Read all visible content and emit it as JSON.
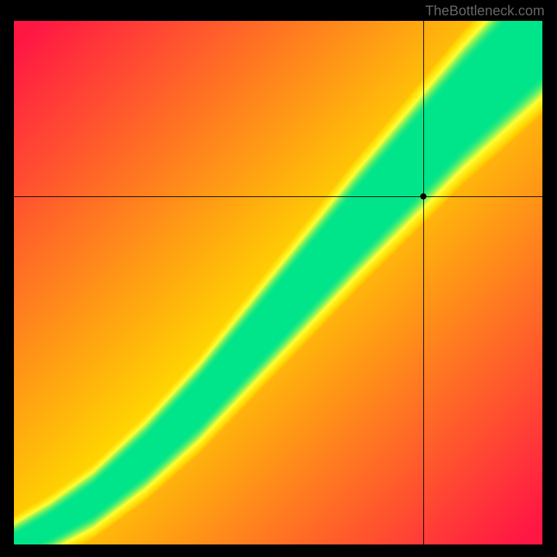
{
  "watermark": "TheBottleneck.com",
  "chart_data": {
    "type": "heatmap",
    "title": "",
    "xlabel": "",
    "ylabel": "",
    "xlim": [
      0,
      1
    ],
    "ylim": [
      0,
      1
    ],
    "marker": {
      "x": 0.775,
      "y": 0.665
    },
    "crosshair": {
      "x": 0.775,
      "y": 0.665
    },
    "color_scale": [
      {
        "value": 0.0,
        "color": "#ff1744"
      },
      {
        "value": 0.55,
        "color": "#ffd500"
      },
      {
        "value": 0.78,
        "color": "#ffff33"
      },
      {
        "value": 1.0,
        "color": "#00e58a"
      }
    ],
    "ridge": {
      "description": "Green optimal band following a slightly super-linear diagonal from (0,0) to (1,1); values fall off with distance from this ridge.",
      "points": [
        {
          "x": 0.0,
          "y": 0.0
        },
        {
          "x": 0.07,
          "y": 0.035
        },
        {
          "x": 0.15,
          "y": 0.085
        },
        {
          "x": 0.25,
          "y": 0.17
        },
        {
          "x": 0.35,
          "y": 0.27
        },
        {
          "x": 0.45,
          "y": 0.385
        },
        {
          "x": 0.55,
          "y": 0.5
        },
        {
          "x": 0.65,
          "y": 0.615
        },
        {
          "x": 0.75,
          "y": 0.725
        },
        {
          "x": 0.85,
          "y": 0.835
        },
        {
          "x": 0.95,
          "y": 0.935
        },
        {
          "x": 1.0,
          "y": 0.985
        }
      ],
      "band_halfwidth_start": 0.015,
      "band_halfwidth_end": 0.085
    }
  }
}
